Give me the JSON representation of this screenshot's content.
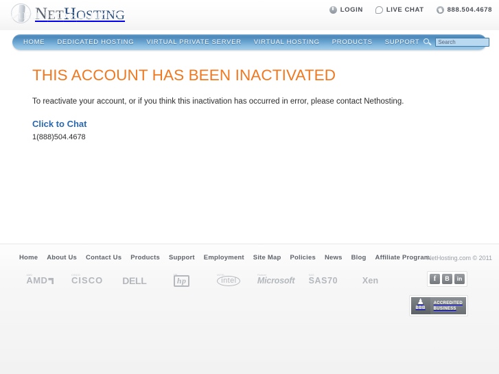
{
  "header": {
    "logo": {
      "part1": "N",
      "part1_rest": "ET",
      "part2": "H",
      "part2_rest": "OSTING",
      "full_text": "NETHOSTING",
      "mark_name": "nethosting-swirl-logo"
    },
    "links": [
      {
        "label": "LOGIN",
        "icon": "power-icon"
      },
      {
        "label": "LIVE CHAT",
        "icon": "chat-bubble-icon"
      },
      {
        "label": "888.504.4678",
        "icon": "phone-icon"
      }
    ]
  },
  "nav": {
    "items": [
      {
        "label": "HOME"
      },
      {
        "label": "DEDICATED HOSTING"
      },
      {
        "label": "VIRTUAL PRIVATE SERVER"
      },
      {
        "label": "VIRTUAL HOSTING"
      },
      {
        "label": "PRODUCTS"
      },
      {
        "label": "SUPPORT"
      }
    ],
    "search": {
      "placeholder": "Search",
      "value": "",
      "icon": "magnifier-icon"
    }
  },
  "main": {
    "title": "THIS ACCOUNT HAS BEEN INACTIVATED",
    "intro": "To reactivate your account, or if you think this inactivation has occurred in error, please contact Nethosting.",
    "chat_link": "Click to Chat",
    "phone": "1(888)504.4678"
  },
  "footer": {
    "nav": [
      {
        "label": "Home"
      },
      {
        "label": "About Us"
      },
      {
        "label": "Contact Us"
      },
      {
        "label": "Products"
      },
      {
        "label": "Support"
      },
      {
        "label": "Employment"
      },
      {
        "label": "Site Map"
      },
      {
        "label": "Policies"
      },
      {
        "label": "News"
      },
      {
        "label": "Blog"
      },
      {
        "label": "Affiliate Program"
      }
    ],
    "copyright": "NetHosting.com © 2011",
    "partners": [
      {
        "name": "AMD",
        "tm": "AMD"
      },
      {
        "name": "CISCO",
        "tm": "CISCO"
      },
      {
        "name": "DELL",
        "tm": "DELL"
      },
      {
        "name": "hp",
        "tm": "HP"
      },
      {
        "name": "intel",
        "tm": "INTEL"
      },
      {
        "name": "Microsoft",
        "tm": "MICROSOFT"
      },
      {
        "name": "SAS70",
        "tm": "SAS70"
      },
      {
        "name": "Xen",
        "tm": "XEN"
      }
    ],
    "social": [
      {
        "label": "f",
        "name": "facebook-icon"
      },
      {
        "label": "B",
        "name": "blogger-icon"
      },
      {
        "label": "in",
        "name": "linkedin-icon"
      }
    ],
    "bbb": {
      "torch": "♟",
      "abbr": "BBB",
      "line1": "ACCREDITED",
      "line2": "BUSINESS"
    }
  },
  "colors": {
    "accent_orange": "#f07820",
    "link_blue": "#2b68ae",
    "nav_blue": "#5b96c6",
    "logo_navy": "#2d4f7c"
  }
}
